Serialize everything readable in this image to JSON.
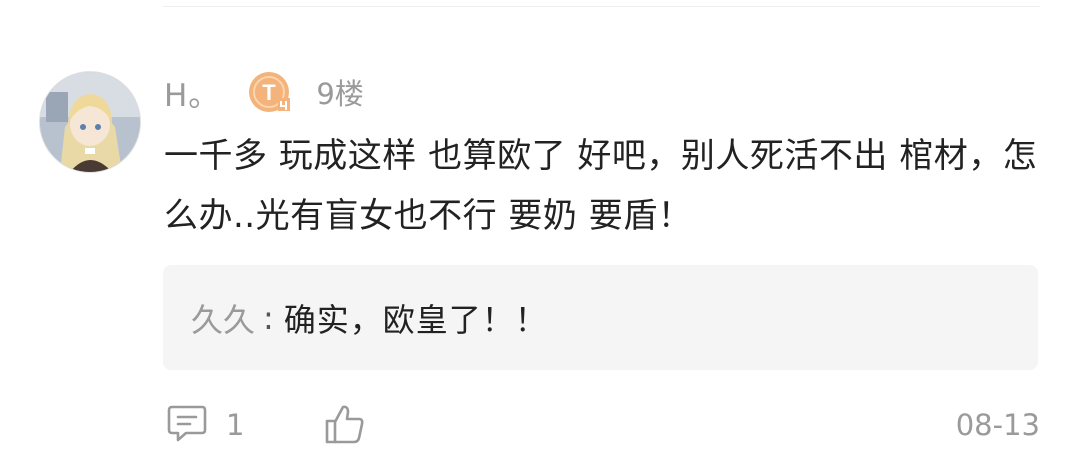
{
  "comment": {
    "username": "H。",
    "level_badge": "T",
    "floor": "9楼",
    "content": "一千多 玩成这样 也算欧了 好吧，别人死活不出 棺材，怎么办..光有盲女也不行 要奶 要盾！",
    "avatar_icon": "anime-girl-avatar"
  },
  "reply": {
    "user": "久久",
    "separator": ":",
    "text": "确实，欧皇了！！"
  },
  "footer": {
    "comment_icon": "comment-icon",
    "comment_count": "1",
    "like_icon": "thumbs-up-icon",
    "date": "08-13"
  },
  "colors": {
    "badge": "#f3b37a",
    "muted_text": "#9a9a9a",
    "body_text": "#222222",
    "reply_bg": "#f5f5f5"
  }
}
